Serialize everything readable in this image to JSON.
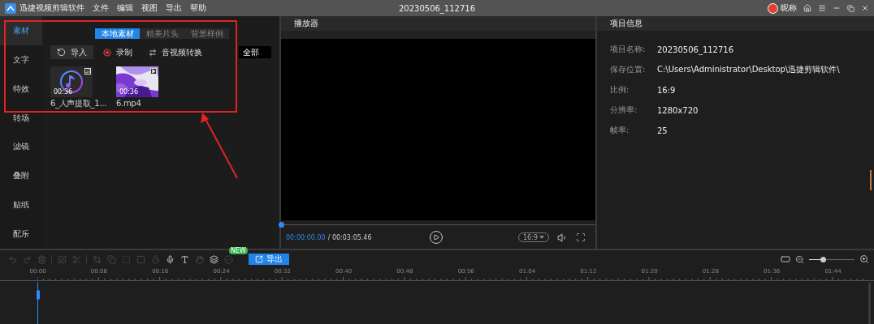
{
  "app": {
    "name": "迅捷视频剪辑软件",
    "menu": [
      "文件",
      "编辑",
      "视图",
      "导出",
      "帮助"
    ],
    "title": "20230506_112716",
    "user": "昵称"
  },
  "sidebar": [
    {
      "label": "素材",
      "selected": true
    },
    {
      "label": "文字",
      "selected": false
    },
    {
      "label": "特效",
      "selected": false
    },
    {
      "label": "转场",
      "selected": false
    },
    {
      "label": "滤镜",
      "selected": false
    },
    {
      "label": "叠附",
      "selected": false
    },
    {
      "label": "贴纸",
      "selected": false
    },
    {
      "label": "配乐",
      "selected": false
    }
  ],
  "media": {
    "tabs": [
      {
        "label": "本地素材",
        "selected": true
      },
      {
        "label": "精美片头",
        "selected": false
      },
      {
        "label": "背景样例",
        "selected": false
      }
    ],
    "actions": [
      {
        "kind": "import",
        "label": "导入"
      },
      {
        "kind": "record",
        "label": "录制"
      },
      {
        "kind": "convert",
        "label": "音视频转换"
      }
    ],
    "filter": "全部",
    "items": [
      {
        "kind": "audio",
        "duration": "00:36",
        "name": "6_人声提取_1..."
      },
      {
        "kind": "video",
        "duration": "00:36",
        "name": "6.mp4"
      }
    ]
  },
  "player": {
    "title": "播放器",
    "level": 0,
    "current_time": "00:00:00.00",
    "total_time": "/ 00:03:05.46",
    "ratio": "16:9"
  },
  "project": {
    "title": "项目信息",
    "fields": [
      {
        "label": "项目名称:",
        "value": "20230506_112716"
      },
      {
        "label": "保存位置:",
        "value": "C:\\Users\\Administrator\\Desktop\\迅捷剪辑软件\\"
      },
      {
        "label": "比例:",
        "value": "16:9"
      },
      {
        "label": "分辨率:",
        "value": "1280x720"
      },
      {
        "label": "帧率:",
        "value": "25"
      }
    ]
  },
  "timeline": {
    "tools": [
      {
        "kind": "undo",
        "disabled": true
      },
      {
        "kind": "redo",
        "disabled": true
      },
      {
        "kind": "delete",
        "disabled": true
      },
      {
        "kind": "divider",
        "disabled": true
      },
      {
        "kind": "edit",
        "disabled": true
      },
      {
        "kind": "cut",
        "disabled": true
      },
      {
        "kind": "divider",
        "disabled": true
      },
      {
        "kind": "crop",
        "disabled": true
      },
      {
        "kind": "copy",
        "disabled": true
      },
      {
        "kind": "freeze",
        "disabled": true
      },
      {
        "kind": "frame",
        "disabled": true
      },
      {
        "kind": "timer",
        "disabled": true
      },
      {
        "kind": "mic",
        "disabled": false
      },
      {
        "kind": "text",
        "disabled": false
      },
      {
        "kind": "hand",
        "disabled": true
      },
      {
        "kind": "layers",
        "disabled": false
      },
      {
        "kind": "check",
        "disabled": true
      }
    ],
    "new_badge": "NEW",
    "export": "导出",
    "zoom_slider": {
      "level": 0.3
    },
    "ruler": [
      "00:00",
      "00:08",
      "00:16",
      "00:24",
      "00:32",
      "00:40",
      "00:48",
      "00:56",
      "01:04",
      "01:12",
      "01:20",
      "01:28",
      "01:36",
      "01:44"
    ]
  }
}
